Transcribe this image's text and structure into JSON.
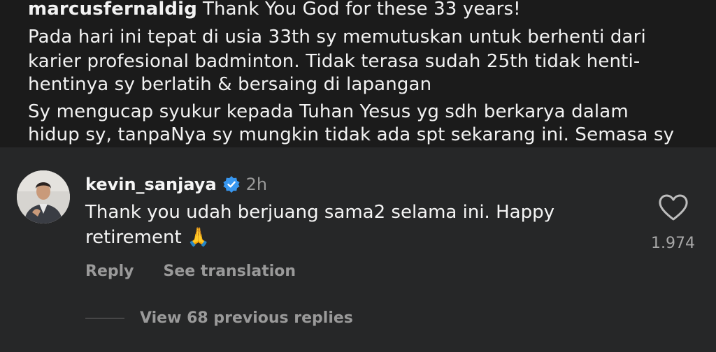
{
  "caption": {
    "username": "marcusfernaldig",
    "lines": [
      "Thank You God for these 33 years!",
      "Pada hari ini tepat di usia 33th sy memutuskan untuk berhenti dari",
      "karier profesional badminton. Tidak terasa sudah 25th tidak henti-",
      "hentinya sy berlatih & bersaing di lapangan",
      "Sy mengucap syukur kepada Tuhan Yesus yg sdh berkarya dalam",
      "hidup sy, tanpaNya sy mungkin tidak ada spt sekarang ini. Semasa sy"
    ]
  },
  "comment": {
    "username": "kevin_sanjaya",
    "time": "2h",
    "text": "Thank you udah berjuang sama2 selama ini. Happy retirement 🙏",
    "likes": "1.974",
    "reply_label": "Reply",
    "translate_label": "See translation",
    "view_replies_label": "View 68 previous replies"
  },
  "icons": {
    "verified": "verified-badge-icon",
    "like": "heart-outline-icon"
  },
  "colors": {
    "background": "#262728",
    "caption_background": "#1b1b1b",
    "verified_blue": "#3897f0",
    "secondary_text": "#9a9a9a"
  }
}
